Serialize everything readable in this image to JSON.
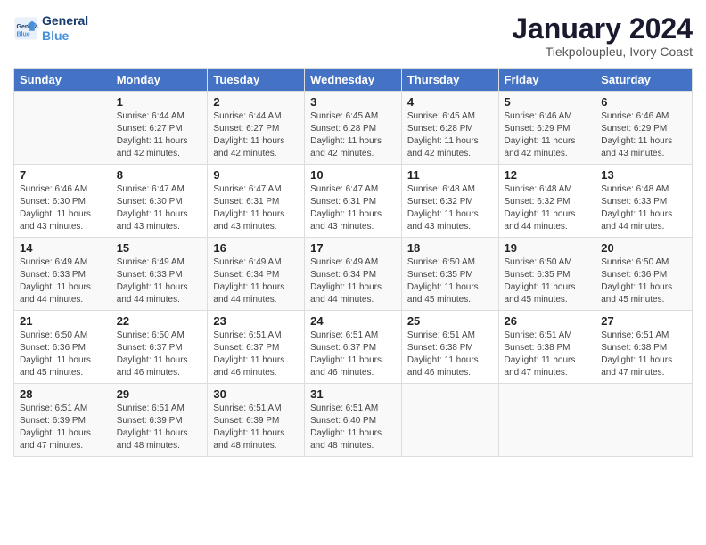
{
  "header": {
    "logo_line1": "General",
    "logo_line2": "Blue",
    "title": "January 2024",
    "location": "Tiekpoloupleu, Ivory Coast"
  },
  "days_of_week": [
    "Sunday",
    "Monday",
    "Tuesday",
    "Wednesday",
    "Thursday",
    "Friday",
    "Saturday"
  ],
  "weeks": [
    [
      {
        "num": "",
        "info": ""
      },
      {
        "num": "1",
        "info": "Sunrise: 6:44 AM\nSunset: 6:27 PM\nDaylight: 11 hours\nand 42 minutes."
      },
      {
        "num": "2",
        "info": "Sunrise: 6:44 AM\nSunset: 6:27 PM\nDaylight: 11 hours\nand 42 minutes."
      },
      {
        "num": "3",
        "info": "Sunrise: 6:45 AM\nSunset: 6:28 PM\nDaylight: 11 hours\nand 42 minutes."
      },
      {
        "num": "4",
        "info": "Sunrise: 6:45 AM\nSunset: 6:28 PM\nDaylight: 11 hours\nand 42 minutes."
      },
      {
        "num": "5",
        "info": "Sunrise: 6:46 AM\nSunset: 6:29 PM\nDaylight: 11 hours\nand 42 minutes."
      },
      {
        "num": "6",
        "info": "Sunrise: 6:46 AM\nSunset: 6:29 PM\nDaylight: 11 hours\nand 43 minutes."
      }
    ],
    [
      {
        "num": "7",
        "info": "Sunrise: 6:46 AM\nSunset: 6:30 PM\nDaylight: 11 hours\nand 43 minutes."
      },
      {
        "num": "8",
        "info": "Sunrise: 6:47 AM\nSunset: 6:30 PM\nDaylight: 11 hours\nand 43 minutes."
      },
      {
        "num": "9",
        "info": "Sunrise: 6:47 AM\nSunset: 6:31 PM\nDaylight: 11 hours\nand 43 minutes."
      },
      {
        "num": "10",
        "info": "Sunrise: 6:47 AM\nSunset: 6:31 PM\nDaylight: 11 hours\nand 43 minutes."
      },
      {
        "num": "11",
        "info": "Sunrise: 6:48 AM\nSunset: 6:32 PM\nDaylight: 11 hours\nand 43 minutes."
      },
      {
        "num": "12",
        "info": "Sunrise: 6:48 AM\nSunset: 6:32 PM\nDaylight: 11 hours\nand 44 minutes."
      },
      {
        "num": "13",
        "info": "Sunrise: 6:48 AM\nSunset: 6:33 PM\nDaylight: 11 hours\nand 44 minutes."
      }
    ],
    [
      {
        "num": "14",
        "info": "Sunrise: 6:49 AM\nSunset: 6:33 PM\nDaylight: 11 hours\nand 44 minutes."
      },
      {
        "num": "15",
        "info": "Sunrise: 6:49 AM\nSunset: 6:33 PM\nDaylight: 11 hours\nand 44 minutes."
      },
      {
        "num": "16",
        "info": "Sunrise: 6:49 AM\nSunset: 6:34 PM\nDaylight: 11 hours\nand 44 minutes."
      },
      {
        "num": "17",
        "info": "Sunrise: 6:49 AM\nSunset: 6:34 PM\nDaylight: 11 hours\nand 44 minutes."
      },
      {
        "num": "18",
        "info": "Sunrise: 6:50 AM\nSunset: 6:35 PM\nDaylight: 11 hours\nand 45 minutes."
      },
      {
        "num": "19",
        "info": "Sunrise: 6:50 AM\nSunset: 6:35 PM\nDaylight: 11 hours\nand 45 minutes."
      },
      {
        "num": "20",
        "info": "Sunrise: 6:50 AM\nSunset: 6:36 PM\nDaylight: 11 hours\nand 45 minutes."
      }
    ],
    [
      {
        "num": "21",
        "info": "Sunrise: 6:50 AM\nSunset: 6:36 PM\nDaylight: 11 hours\nand 45 minutes."
      },
      {
        "num": "22",
        "info": "Sunrise: 6:50 AM\nSunset: 6:37 PM\nDaylight: 11 hours\nand 46 minutes."
      },
      {
        "num": "23",
        "info": "Sunrise: 6:51 AM\nSunset: 6:37 PM\nDaylight: 11 hours\nand 46 minutes."
      },
      {
        "num": "24",
        "info": "Sunrise: 6:51 AM\nSunset: 6:37 PM\nDaylight: 11 hours\nand 46 minutes."
      },
      {
        "num": "25",
        "info": "Sunrise: 6:51 AM\nSunset: 6:38 PM\nDaylight: 11 hours\nand 46 minutes."
      },
      {
        "num": "26",
        "info": "Sunrise: 6:51 AM\nSunset: 6:38 PM\nDaylight: 11 hours\nand 47 minutes."
      },
      {
        "num": "27",
        "info": "Sunrise: 6:51 AM\nSunset: 6:38 PM\nDaylight: 11 hours\nand 47 minutes."
      }
    ],
    [
      {
        "num": "28",
        "info": "Sunrise: 6:51 AM\nSunset: 6:39 PM\nDaylight: 11 hours\nand 47 minutes."
      },
      {
        "num": "29",
        "info": "Sunrise: 6:51 AM\nSunset: 6:39 PM\nDaylight: 11 hours\nand 48 minutes."
      },
      {
        "num": "30",
        "info": "Sunrise: 6:51 AM\nSunset: 6:39 PM\nDaylight: 11 hours\nand 48 minutes."
      },
      {
        "num": "31",
        "info": "Sunrise: 6:51 AM\nSunset: 6:40 PM\nDaylight: 11 hours\nand 48 minutes."
      },
      {
        "num": "",
        "info": ""
      },
      {
        "num": "",
        "info": ""
      },
      {
        "num": "",
        "info": ""
      }
    ]
  ]
}
